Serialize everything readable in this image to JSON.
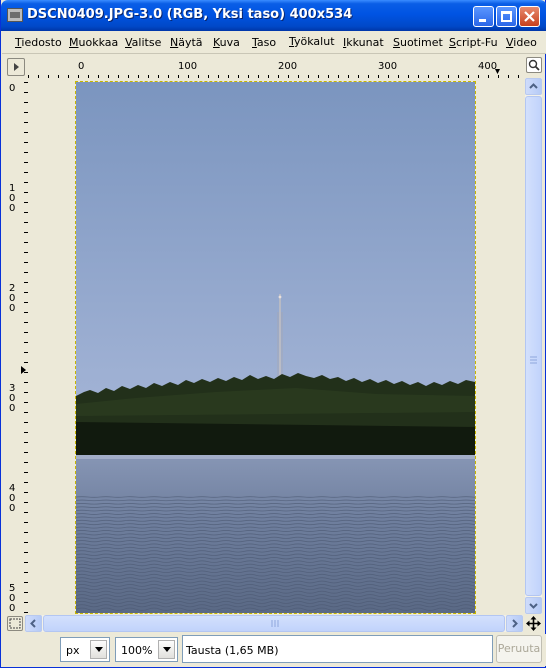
{
  "window": {
    "title": "DSCN0409.JPG-3.0 (RGB, Yksi taso) 400x534",
    "app_icon": "gimp-image-icon",
    "controls": [
      "minimize-icon",
      "maximize-icon",
      "close-icon"
    ]
  },
  "menu": {
    "items": [
      {
        "label": "Tiedosto"
      },
      {
        "label": "Muokkaa"
      },
      {
        "label": "Valitse"
      },
      {
        "label": "Näytä"
      },
      {
        "label": "Kuva"
      },
      {
        "label": "Taso"
      },
      {
        "label": "Työkalut"
      },
      {
        "label": "Ikkunat"
      },
      {
        "label": "Suotimet"
      },
      {
        "label": "Script-Fu"
      },
      {
        "label": "Video"
      }
    ]
  },
  "rulers": {
    "horizontal_labels": [
      "0",
      "100",
      "200",
      "300",
      "400"
    ],
    "vertical_labels": [
      "0",
      "1\n0\n0",
      "2\n0\n0",
      "3\n0\n0",
      "4\n0\n0",
      "5\n0\n0"
    ]
  },
  "statusbar": {
    "unit": "px",
    "zoom": "100%",
    "status_text": "Tausta (1,65 MB)",
    "cancel_label": "Peruuta"
  },
  "colors": {
    "titlebar": "#0054e3",
    "sky_top": "#7b95bf",
    "sky_bottom": "#b6c0dc",
    "forest": "#1e2a16",
    "water": "#7989a8",
    "selection_outline": "#c8b800"
  }
}
